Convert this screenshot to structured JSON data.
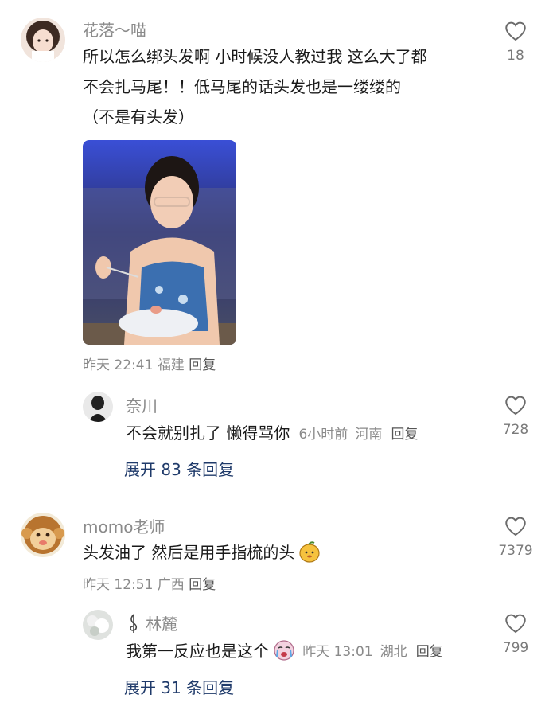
{
  "comments": [
    {
      "username": "花落～喵",
      "lines": [
        "所以怎么绑头发啊 小时候没人教过我 这么大了都",
        "不会扎马尾！！低马尾的话头发也是一缕缕的",
        "（不是有头发）"
      ],
      "time": "昨天 22:41",
      "location": "福建",
      "reply_label": "回复",
      "likes": "18",
      "replies": [
        {
          "username": "奈川",
          "text": "不会就别扎了 懒得骂你",
          "time": "6小时前",
          "location": "河南",
          "reply_label": "回复",
          "likes": "728"
        }
      ],
      "expand_label": "展开 83 条回复"
    },
    {
      "username": "momo老师",
      "text": "头发油了 然后是用手指梳的头",
      "time": "昨天 12:51",
      "location": "广西",
      "reply_label": "回复",
      "likes": "7379",
      "replies": [
        {
          "username": "林麓",
          "text": "我第一反应也是这个",
          "time": "昨天 13:01",
          "location": "湖北",
          "reply_label": "回复",
          "likes": "799"
        }
      ],
      "expand_label": "展开 31 条回复"
    }
  ],
  "icons": {
    "like": "heart-outline-icon",
    "emoji_1": "mango-face-emoji",
    "emoji_2": "crying-face-emoji"
  },
  "colors": {
    "username": "#8a8a8a",
    "expand_link": "#1f3a6a"
  }
}
